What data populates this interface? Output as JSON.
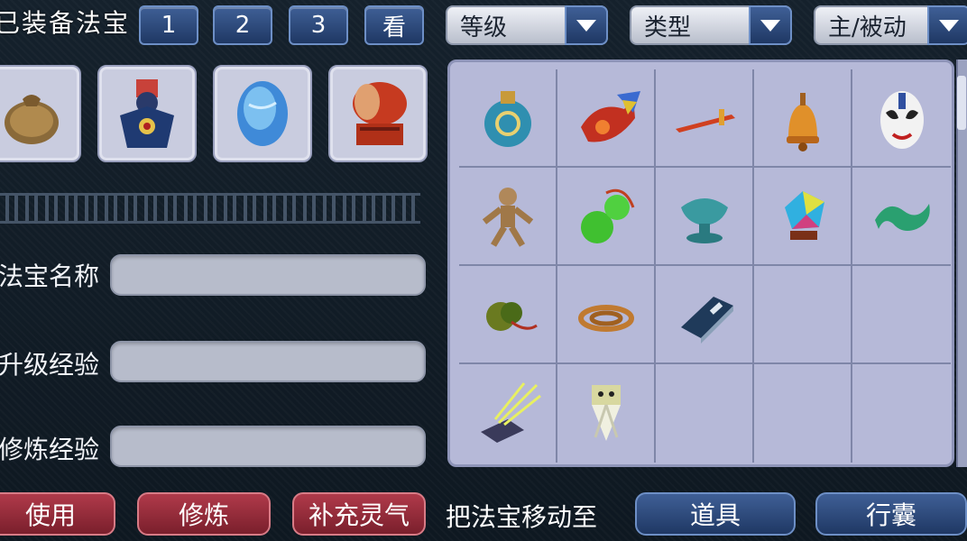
{
  "header": {
    "title": "已装备法宝",
    "tabs": [
      "1",
      "2",
      "3"
    ],
    "view_label": "看",
    "dropdowns": {
      "level": "等级",
      "type": "类型",
      "mode": "主/被动"
    }
  },
  "equipped_slots": [
    {
      "icon": "pouch-bag-icon"
    },
    {
      "icon": "armored-figure-icon"
    },
    {
      "icon": "blue-jade-stone-icon"
    },
    {
      "icon": "red-drum-icon"
    }
  ],
  "fields": {
    "name_label": "法宝名称",
    "upgrade_exp_label": "升级经验",
    "cultivation_exp_label": "修炼经验",
    "name_value": "",
    "upgrade_exp_value": "",
    "cultivation_exp_value": ""
  },
  "inventory": {
    "items": [
      "vase-icon",
      "dragon-fan-icon",
      "flying-sword-icon",
      "bell-icon",
      "opera-mask-icon",
      "wooden-doll-icon",
      "green-gourd-icon",
      "jade-bowl-icon",
      "crystal-stone-icon",
      "jade-dragon-icon",
      "herb-bundle-icon",
      "rope-coil-icon",
      "blue-book-icon",
      "",
      "",
      "glowing-box-icon",
      "paper-charm-icon",
      "",
      "",
      ""
    ]
  },
  "actions": {
    "use_label": "使用",
    "cultivate_label": "修炼",
    "replenish_label": "补充灵气",
    "move_to_label": "把法宝移动至",
    "item_label": "道具",
    "bag_label": "行囊"
  },
  "colors": {
    "tab_blue": "#2d4a7e",
    "action_red": "#94293a",
    "grid_bg": "#b6b9d8",
    "field_bg": "#b7bccb"
  }
}
